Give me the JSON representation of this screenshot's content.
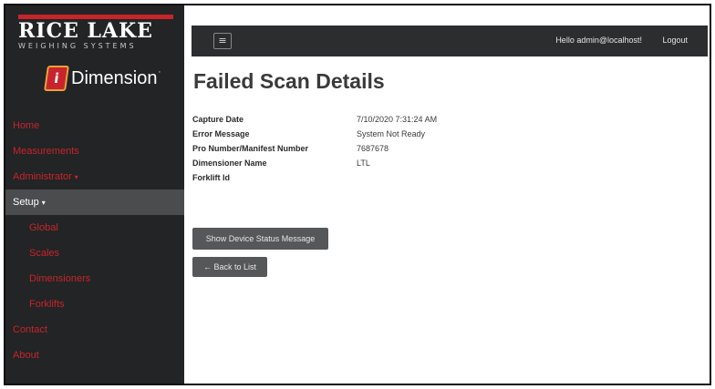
{
  "brand": {
    "company": "RICE LAKE",
    "company_sub": "WEIGHING SYSTEMS",
    "product": "Dimension",
    "product_mark": "·"
  },
  "sidebar": {
    "items": [
      {
        "label": "Home"
      },
      {
        "label": "Measurements"
      },
      {
        "label": "Administrator",
        "caret": "▾"
      },
      {
        "label": "Setup",
        "caret": "▾"
      },
      {
        "label": "Global"
      },
      {
        "label": "Scales"
      },
      {
        "label": "Dimensioners"
      },
      {
        "label": "Forklifts"
      },
      {
        "label": "Contact"
      },
      {
        "label": "About"
      }
    ]
  },
  "topbar": {
    "menu_icon": "≡",
    "hello": "Hello admin@localhost!",
    "logout": "Logout"
  },
  "page": {
    "title": "Failed Scan Details"
  },
  "details": {
    "rows": [
      {
        "label": "Capture Date",
        "value": "7/10/2020 7:31:24 AM"
      },
      {
        "label": "Error Message",
        "value": "System Not Ready"
      },
      {
        "label": "Pro Number/Manifest Number",
        "value": "7687678"
      },
      {
        "label": "Dimensioner Name",
        "value": "LTL"
      },
      {
        "label": "Forklift Id",
        "value": ""
      }
    ]
  },
  "buttons": {
    "status": "Show Device Status Message",
    "back": "← Back to List"
  },
  "colors": {
    "brand_red": "#c8242c",
    "sidebar_bg": "#222425",
    "active_bg": "#4a4c4d",
    "topbar_bg": "#2b2d2e",
    "button_bg": "#555758"
  }
}
